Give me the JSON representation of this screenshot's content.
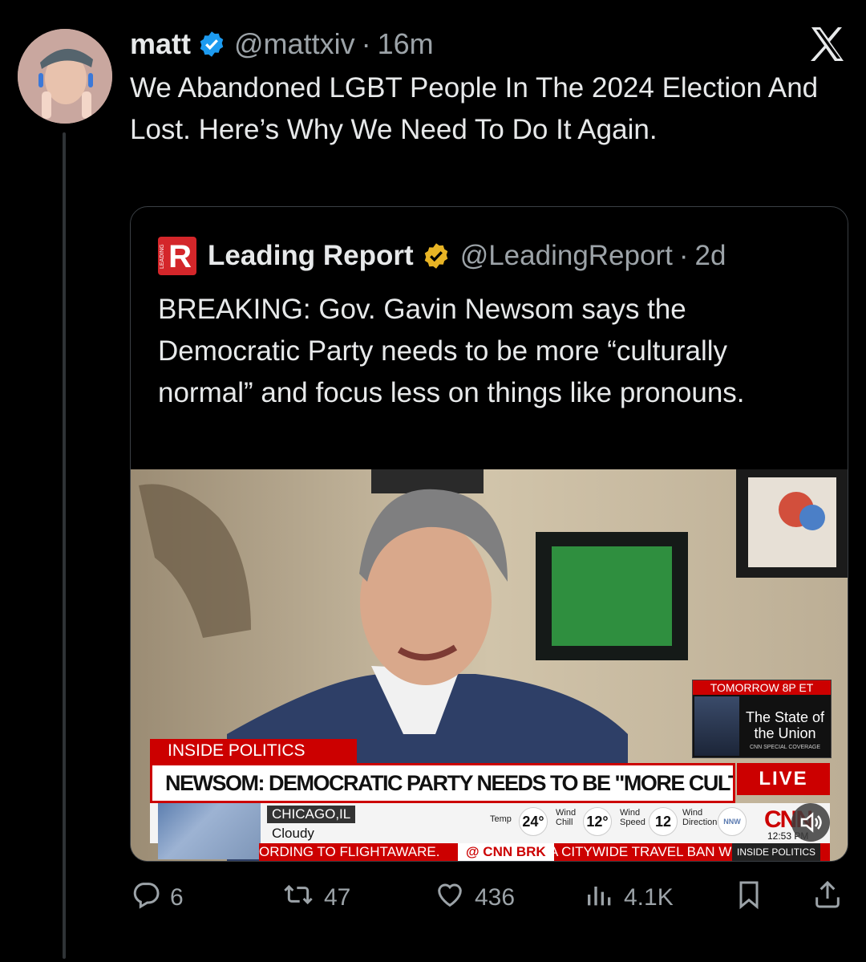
{
  "post": {
    "author_name": "matt",
    "handle": "@mattxiv",
    "separator": "·",
    "time": "16m",
    "text": "We Abandoned LGBT People In The 2024 Election And Lost. Here’s Why We Need To Do It Again."
  },
  "quote": {
    "author_name": "Leading Report",
    "logo_letter": "R",
    "logo_vertical_text": "LEADING",
    "handle": "@LeadingReport",
    "separator": "·",
    "time": "2d",
    "text": "BREAKING: Gov. Gavin Newsom says the Democratic Party needs to be more “culturally normal” and focus less on things like pronouns."
  },
  "broadcast": {
    "show_label": "INSIDE POLITICS",
    "headline": "NEWSOM: DEMOCRATIC PARTY NEEDS TO BE \"MORE CULTURALLY NORMAL\"",
    "live_label": "LIVE",
    "promo_time": "TOMORROW 8P ET",
    "promo_title": "The State of the Union",
    "promo_sub": "CNN SPECIAL COVERAGE",
    "weather_city": "CHICAGO,IL",
    "weather_condition": "Cloudy",
    "temp_label": "Temp",
    "temp_value": "24°",
    "wind_chill_label": "Wind Chill",
    "wind_chill_value": "12°",
    "wind_speed_label": "Wind Speed",
    "wind_speed_value": "12",
    "wind_dir_label": "Wind Direction",
    "wind_dir_value": "NNW",
    "clock": "12:53 PM",
    "ticker_1": "ORDING TO FLIGHTAWARE.",
    "ticker_2": "@ CNN BRK",
    "ticker_3": "A CITYWIDE TRAVEL BAN W",
    "ticker_4": "INSIDE POLITICS",
    "network": "CNN"
  },
  "actions": {
    "replies": "6",
    "reposts": "47",
    "likes": "436",
    "views": "4.1K"
  },
  "colors": {
    "background": "#000000",
    "text_primary": "#e7e9ea",
    "text_secondary": "#9ca3a8",
    "verified_blue": "#1d9bf0",
    "verified_gold": "#e8b425",
    "cnn_red": "#cc0000"
  },
  "icons": [
    "x-logo-icon",
    "verified-blue-icon",
    "verified-gold-icon",
    "reply-icon",
    "repost-icon",
    "like-icon",
    "views-icon",
    "bookmark-icon",
    "share-icon",
    "sound-icon"
  ]
}
